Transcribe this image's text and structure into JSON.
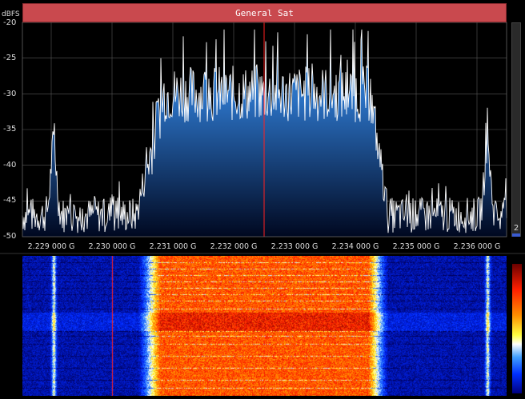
{
  "header": {
    "title": "General Sat"
  },
  "spectrum": {
    "unit_label": "dBFS",
    "y_ticks": [
      "-20",
      "-25",
      "-30",
      "-35",
      "-40",
      "-45",
      "-50"
    ],
    "x_ticks": [
      "2.229 000 G",
      "2.230 000 G",
      "2.231 000 G",
      "2.232 000 G",
      "2.233 000 G",
      "2.234 000 G",
      "2.235 000 G",
      "2.236 000 G"
    ],
    "trace_color": "#ffffff",
    "fill_top_color": "#3a8fe0",
    "fill_bottom_color": "#000820",
    "center_marker_color": "#ff2020"
  },
  "scroll": {
    "indicator": "2"
  },
  "waterfall": {
    "palette": [
      "#000080",
      "#0030ff",
      "#40a0ff",
      "#ffffff",
      "#ffff40",
      "#ff9000",
      "#ff2000",
      "#6a0000"
    ]
  }
}
